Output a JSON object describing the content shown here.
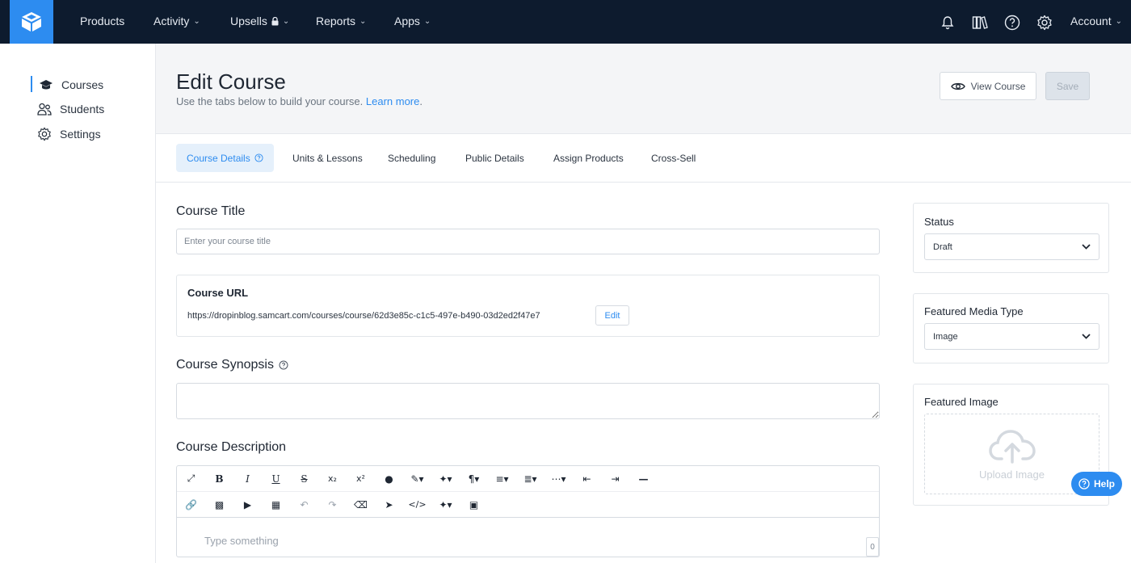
{
  "topnav": {
    "items": [
      {
        "label": "Products",
        "dropdown": false
      },
      {
        "label": "Activity",
        "dropdown": true
      },
      {
        "label": "Upsells",
        "dropdown": true,
        "locked": true
      },
      {
        "label": "Reports",
        "dropdown": true
      },
      {
        "label": "Apps",
        "dropdown": true
      }
    ],
    "icons": [
      "bell-icon",
      "library-icon",
      "help-circle-icon",
      "gear-icon"
    ],
    "account_label": "Account"
  },
  "sidebar": {
    "items": [
      {
        "label": "Courses",
        "icon": "graduation-cap-icon",
        "active": true
      },
      {
        "label": "Students",
        "icon": "users-icon",
        "active": false
      },
      {
        "label": "Settings",
        "icon": "gear-icon",
        "active": false
      }
    ]
  },
  "header": {
    "title": "Edit Course",
    "subtitle": "Use the tabs below to build your course.",
    "learn_more": "Learn more",
    "subtitle_end": ".",
    "view_course_label": "View Course",
    "save_label": "Save"
  },
  "tabs": [
    {
      "label": "Course Details",
      "active": true
    },
    {
      "label": "Units & Lessons",
      "active": false
    },
    {
      "label": "Scheduling",
      "active": false
    },
    {
      "label": "Public Details",
      "active": false
    },
    {
      "label": "Assign Products",
      "active": false
    },
    {
      "label": "Cross-Sell",
      "active": false
    }
  ],
  "form": {
    "title_label": "Course Title",
    "title_placeholder": "Enter your course title",
    "url_label": "Course URL",
    "url_value": "https://dropinblog.samcart.com/courses/course/62d3e85c-c1c5-497e-b490-03d2ed2f47e7",
    "url_edit_label": "Edit",
    "synopsis_label": "Course Synopsis",
    "description_label": "Course Description",
    "editor_placeholder": "Type something",
    "char_count": "0"
  },
  "right_panel": {
    "status_label": "Status",
    "status_value": "Draft",
    "media_type_label": "Featured Media Type",
    "media_type_value": "Image",
    "featured_image_label": "Featured Image",
    "upload_label": "Upload Image"
  },
  "help_label": "Help",
  "colors": {
    "nav_bg": "#0d1b2e",
    "accent": "#2d8cf0",
    "header_bg": "#f4f5f7"
  }
}
